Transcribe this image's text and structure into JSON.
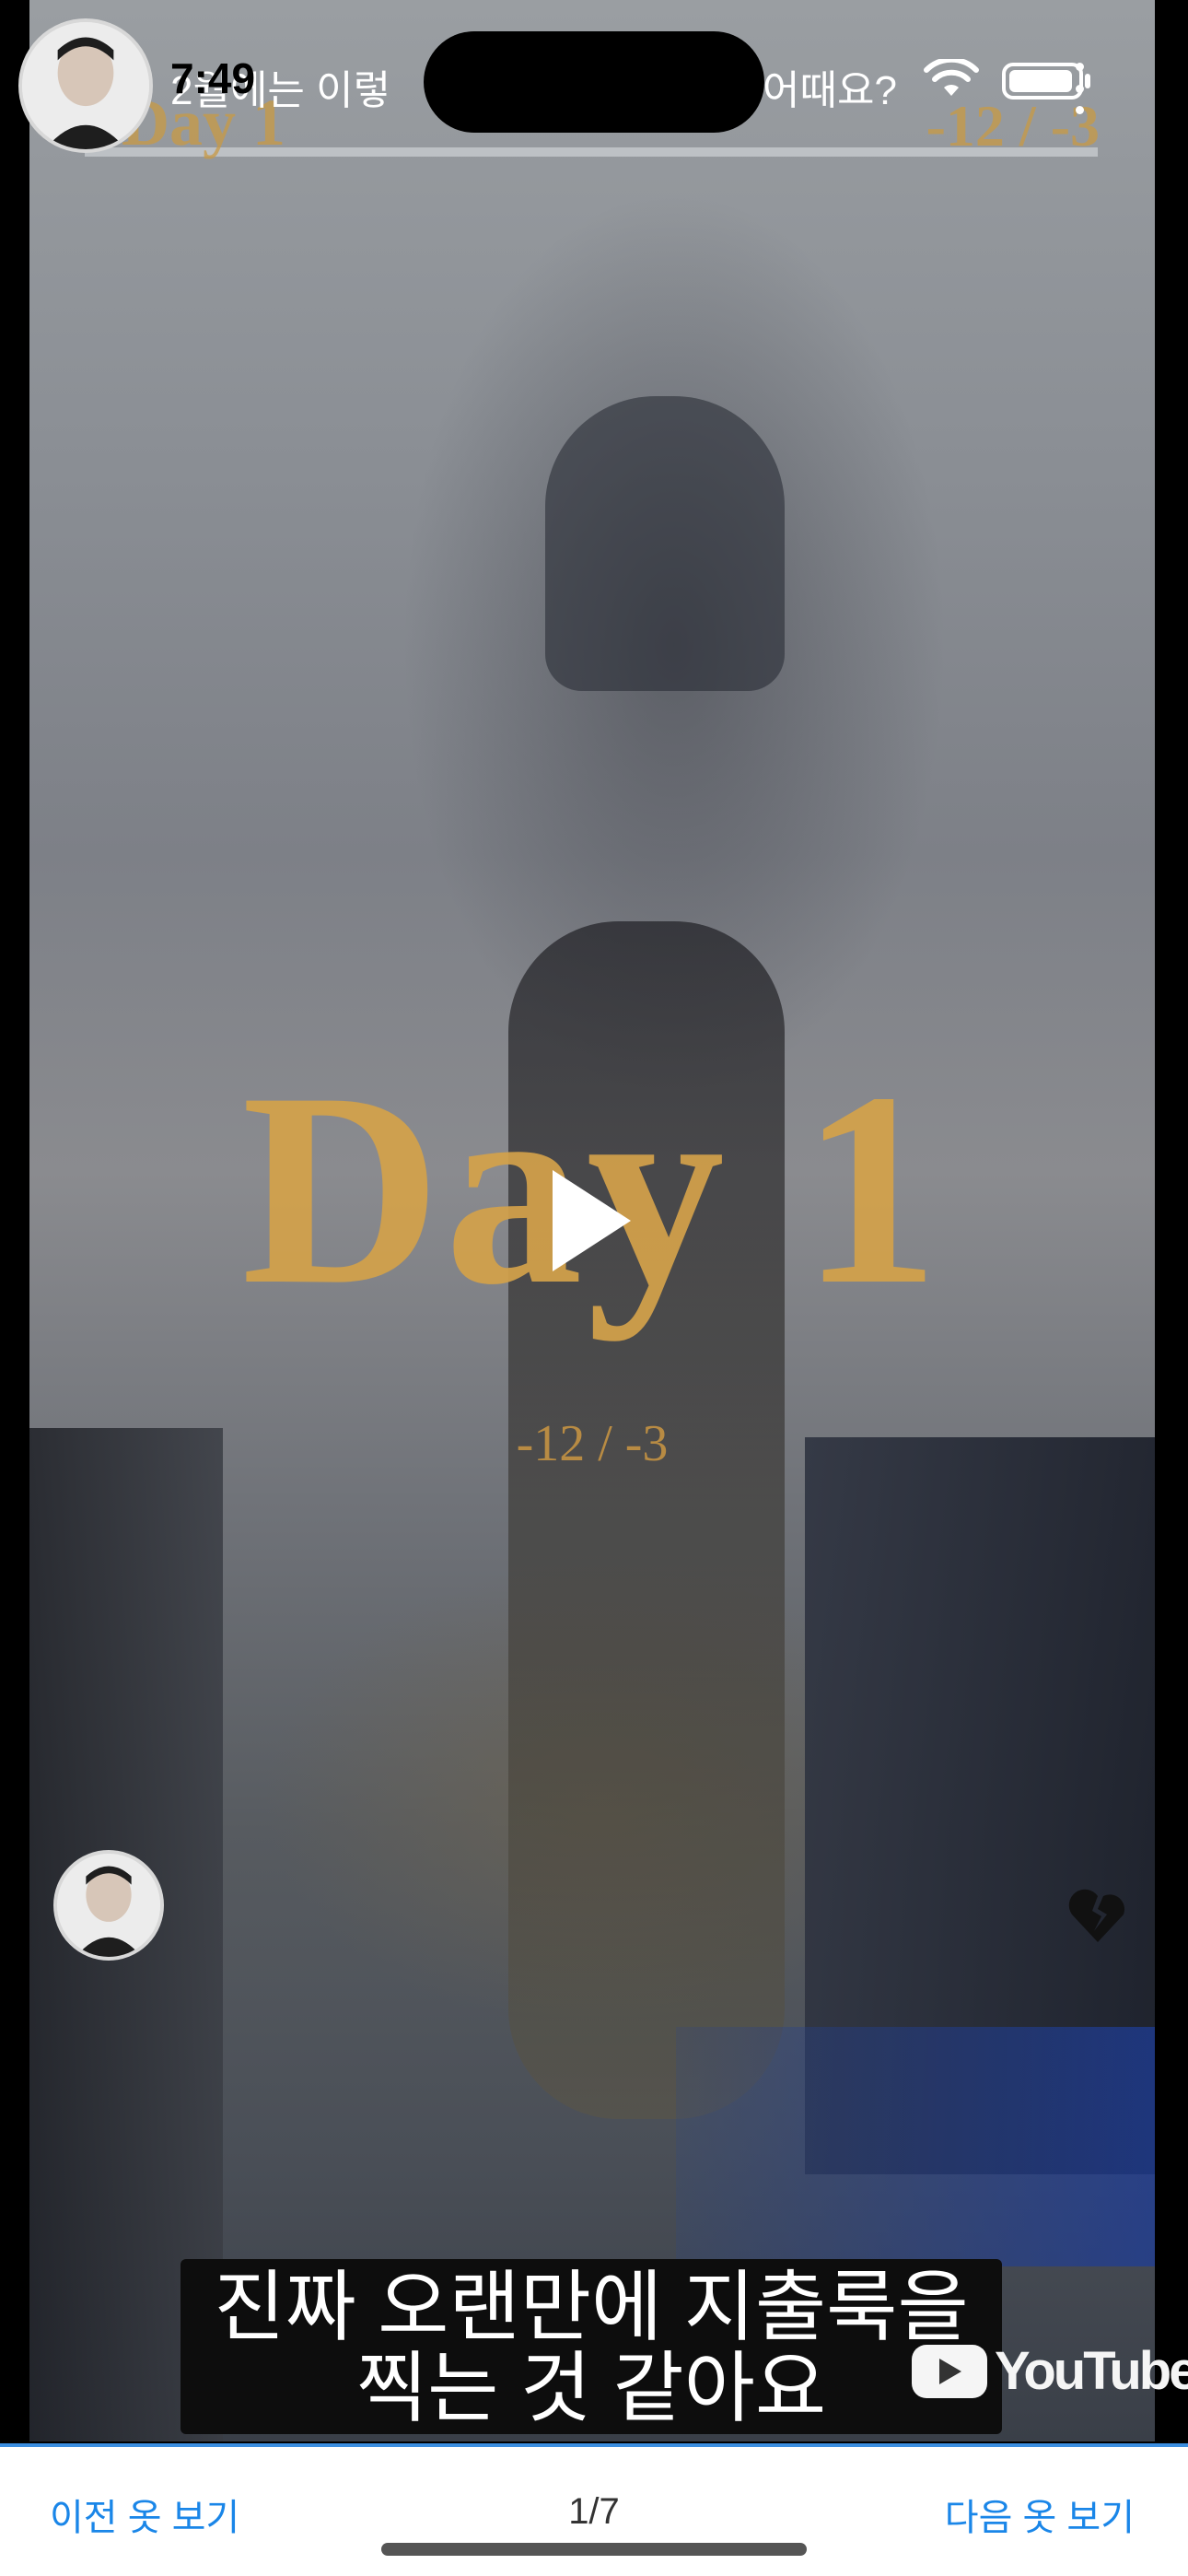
{
  "status_bar": {
    "time": "7:49"
  },
  "video": {
    "title_left": "2월에는 이렇",
    "title_right": "어때요?",
    "overlay_day_small": "Day 1",
    "overlay_temp_small": "-12 / -3",
    "overlay_day_big": "Day 1",
    "overlay_temp_big": "-12 / -3",
    "subtitle_line1": "진짜 오랜만에 지출룩을",
    "subtitle_line2": "찍는 것 같아요",
    "brand": "YouTube",
    "icons": [
      "play-icon",
      "broken-heart-icon",
      "youtube-logo-icon",
      "wifi-icon",
      "battery-icon",
      "more-icon"
    ]
  },
  "footer": {
    "prev_label": "이전 옷 보기",
    "next_label": "다음 옷 보기",
    "pager": "1/7"
  },
  "colors": {
    "accent": "#1a86e8",
    "overlay_gold": "#d4a24a"
  }
}
